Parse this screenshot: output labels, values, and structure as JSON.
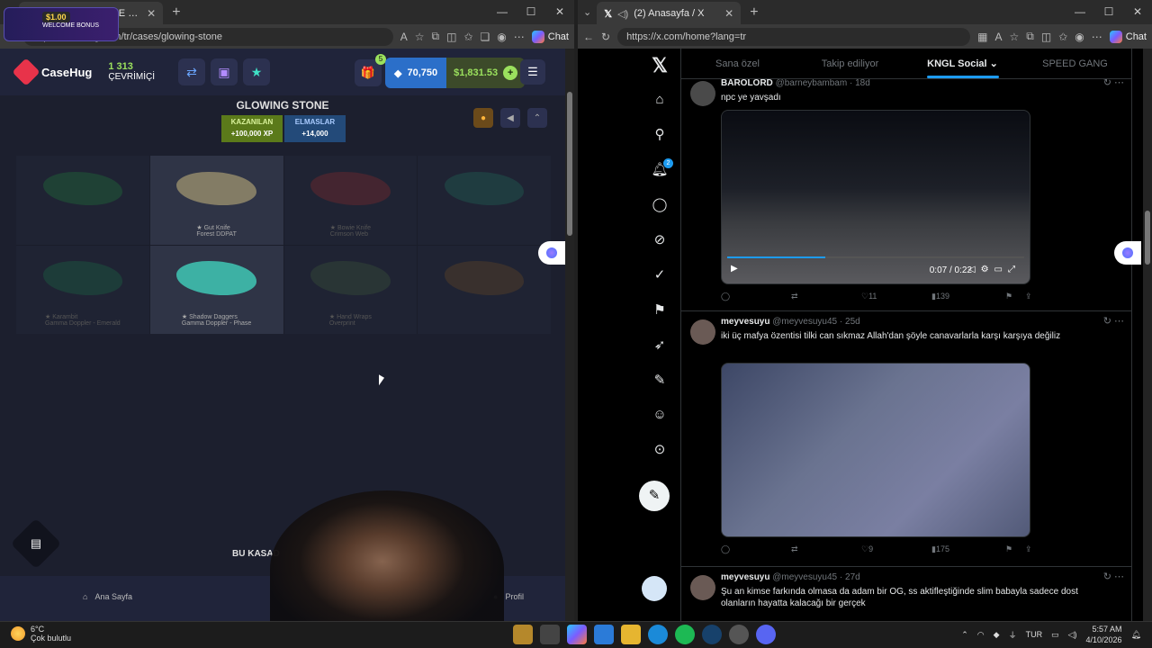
{
  "left_browser": {
    "tab_title": "GLOWING STONE CS2 (CS:GO) Ka",
    "url": "https://casehug.com/tr/cases/glowing-stone",
    "chat_label": "Chat"
  },
  "casehug": {
    "brand": "CaseHug",
    "level_value": "1 313",
    "level_label": "ÇEVRİMİÇİ",
    "gift_badge": "5",
    "gems": "70,750",
    "cash": "$1,831.53",
    "case_title": "GLOWING STONE",
    "earn_label": "KAZANILAN",
    "earn_value": "+100,000 XP",
    "gems_label": "ELMASLAR",
    "gems_value": "+14,000",
    "items": [
      {
        "name": "",
        "skin": ""
      },
      {
        "name": "★ Gut Knife",
        "skin": "Forest DDPAT"
      },
      {
        "name": "★ Bowie Knife",
        "skin": "Crimson Web"
      },
      {
        "name": "",
        "skin": ""
      },
      {
        "name": "★ Karambit",
        "skin": "Gamma Doppler - Emerald"
      },
      {
        "name": "★ Shadow Daggers",
        "skin": "Gamma Doppler - Phase"
      },
      {
        "name": "★ Hand Wraps",
        "skin": "Overprint"
      },
      {
        "name": "",
        "skin": ""
      }
    ],
    "bottom_heading": "BU KASAD",
    "nav_home": "Ana Sayfa",
    "nav_profile": "Profil"
  },
  "promo": {
    "amount": "$1.00",
    "label": "WELCOME BONUS"
  },
  "right_browser": {
    "tab_title": "(2) Anasayfa / X",
    "url": "https://x.com/home?lang=tr",
    "chat_label": "Chat"
  },
  "x": {
    "notif_count": "2",
    "tabs": [
      "Sana özel",
      "Takip ediliyor",
      "KNGL Social",
      "SPEED GANG"
    ],
    "posts": [
      {
        "name": "BAROLORD",
        "handle": "@barneybambam · 18d",
        "text": "npc ye yavşadı",
        "time": "0:07 / 0:22",
        "replies": "",
        "likes": "11",
        "views": "139"
      },
      {
        "name": "meyvesuyu",
        "handle": "@meyvesuyu45 · 25d",
        "text": "iki üç mafya özentisi tilki can sıkmaz Allah'dan şöyle canavarlarla karşı karşıya değiliz",
        "likes": "9",
        "views": "175"
      },
      {
        "name": "meyvesuyu",
        "handle": "@meyvesuyu45 · 27d",
        "text": "Şu an kimse farkında olmasa da adam bir OG, ss aktifleştiğinde slim babayla sadece dost olanların hayatta kalacağı bir gerçek"
      }
    ]
  },
  "taskbar": {
    "temp": "6°C",
    "weather": "Çok bulutlu",
    "lang": "TUR",
    "time": "5:57 AM",
    "date": "4/10/2026"
  }
}
